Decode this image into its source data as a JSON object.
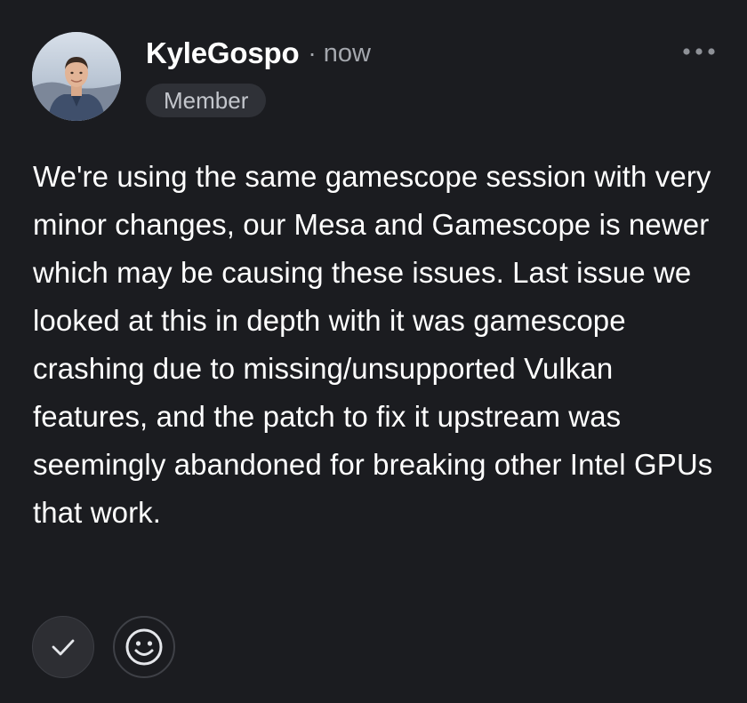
{
  "post": {
    "author": "KyleGospo",
    "separator": "·",
    "timestamp": "now",
    "role": "Member",
    "body": "We're using the same gamescope session with very minor changes, our Mesa and Gamescope is newer which may be causing these issues. Last issue we looked at this in depth with it was gamescope crashing due to missing/unsupported Vulkan features, and the patch to fix it upstream was seemingly abandoned for breaking other Intel GPUs that work."
  },
  "icons": {
    "more": "more-horizontal-icon",
    "check": "checkmark-icon",
    "reaction": "smiley-face-icon"
  },
  "colors": {
    "background": "#1b1c20",
    "text": "#ffffff",
    "muted": "#a4a7ad",
    "badge_bg": "#2f3137"
  }
}
